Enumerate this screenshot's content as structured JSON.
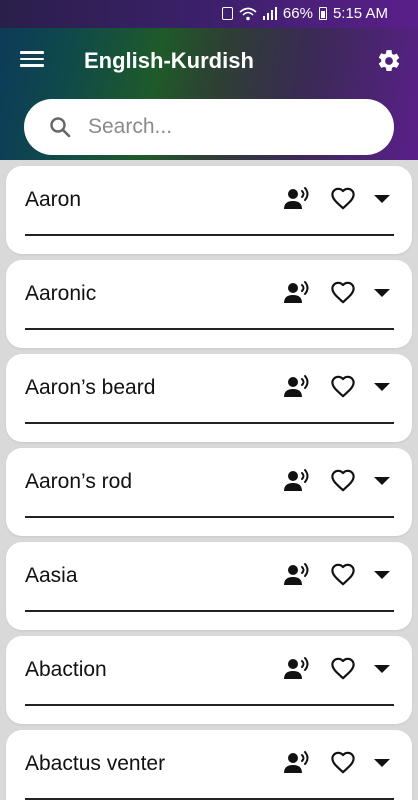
{
  "status_bar": {
    "battery": "66%",
    "time": "5:15 AM"
  },
  "app_bar": {
    "title": "English-Kurdish",
    "menu_icon": "hamburger-menu-icon",
    "settings_icon": "gear-icon"
  },
  "search": {
    "placeholder": "Search...",
    "value": "",
    "icon": "search-icon"
  },
  "words": [
    {
      "word": "Aaron"
    },
    {
      "word": "Aaronic"
    },
    {
      "word": "Aaron’s beard"
    },
    {
      "word": "Aaron’s rod"
    },
    {
      "word": "Aasia"
    },
    {
      "word": "Abaction"
    },
    {
      "word": "Abactus venter"
    }
  ],
  "row_icons": {
    "speak": "speaker-voice-icon",
    "favorite": "heart-outline-icon",
    "expand": "caret-down-icon"
  }
}
